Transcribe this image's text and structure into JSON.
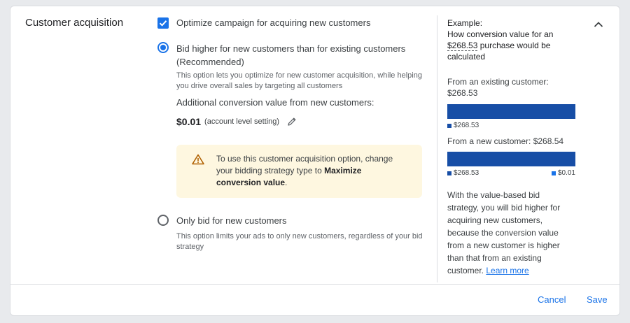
{
  "section": {
    "title": "Customer acquisition"
  },
  "optimize": {
    "checked": true,
    "label": "Optimize campaign for acquiring new customers"
  },
  "options": [
    {
      "selected": true,
      "label_line1": "Bid higher for new customers than for existing customers",
      "label_line2": "(Recommended)",
      "desc_line1": "This option lets you optimize for new customer acquisition, while helping",
      "desc_line2": "you drive overall sales by targeting all customers"
    },
    {
      "selected": false,
      "label": "Only bid for new customers",
      "desc_line1": "This option limits your ads to only new customers, regardless of your bid",
      "desc_line2": "strategy"
    }
  ],
  "additional_value": {
    "label": "Additional conversion value from new customers:",
    "amount": "$0.01",
    "note": "(account level setting)"
  },
  "warning": {
    "text_line1": "To use this customer acquisition option, change",
    "text_line2_pre": "your bidding strategy type to ",
    "text_bold_a": "Maximize",
    "text_bold_b": "conversion value",
    "text_tail": "."
  },
  "example": {
    "heading": "Example:",
    "line1": "How conversion value for an",
    "amount": "$268.53",
    "line2_rest": " purchase would be",
    "line3": "calculated",
    "existing_label_line1": "From an existing customer:",
    "existing_label_line2": "$268.53",
    "new_label": "From a new customer: $268.54",
    "chart_data": {
      "type": "bar",
      "orientation": "horizontal",
      "stacked": true,
      "categories": [
        "From an existing customer",
        "From a new customer"
      ],
      "series": [
        {
          "name": "$268.53",
          "values": [
            268.53,
            268.53
          ],
          "color": "#174ea6"
        },
        {
          "name": "$0.01",
          "values": [
            0,
            0.01
          ],
          "color": "#1a73e8"
        }
      ],
      "legend_existing": [
        "$268.53"
      ],
      "legend_new": [
        "$268.53",
        "$0.01"
      ]
    },
    "body_lines": [
      "With the value-based bid",
      "strategy, you will bid higher for",
      "acquiring new customers,",
      "because the conversion value",
      "from a new customer is higher",
      "than that from an existing"
    ],
    "body_last": "customer. ",
    "learn_more": "Learn more"
  },
  "icons": {
    "checkbox": "check-icon",
    "edit": "pencil-icon",
    "warning": "warning-triangle-icon",
    "collapse": "chevron-up-icon"
  },
  "footer": {
    "cancel": "Cancel",
    "save": "Save"
  },
  "colors": {
    "accent": "#1a73e8",
    "bar_dark": "#174ea6",
    "warning_bg": "#fef7e0",
    "warning_icon": "#b06000"
  }
}
